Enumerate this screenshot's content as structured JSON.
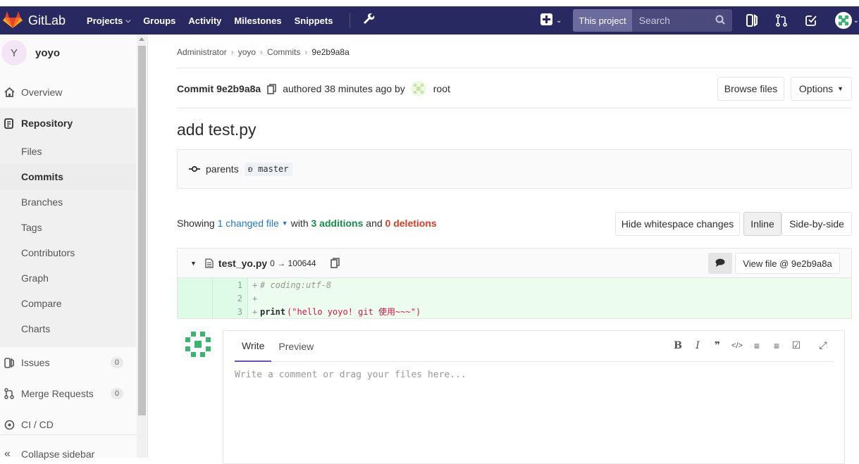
{
  "topbar": {
    "brand": "GitLab",
    "nav": [
      "Projects",
      "Groups",
      "Activity",
      "Milestones",
      "Snippets"
    ],
    "search_scope": "This project",
    "search_placeholder": "Search"
  },
  "sidebar": {
    "project_initial": "Y",
    "project_name": "yoyo",
    "overview": "Overview",
    "repository": "Repository",
    "repo_items": [
      "Files",
      "Commits",
      "Branches",
      "Tags",
      "Contributors",
      "Graph",
      "Compare",
      "Charts"
    ],
    "issues": "Issues",
    "issues_count": "0",
    "merge_requests": "Merge Requests",
    "mr_count": "0",
    "ci_cd": "CI / CD",
    "collapse": "Collapse sidebar"
  },
  "breadcrumb": [
    "Administrator",
    "yoyo",
    "Commits",
    "9e2b9a8a"
  ],
  "commit": {
    "label": "Commit",
    "sha": "9e2b9a8a",
    "authored": "authored 38 minutes ago by",
    "author": "root",
    "browse_files": "Browse files",
    "options": "Options",
    "title": "add test.py",
    "parents_label": "parents",
    "parent_ref": "master"
  },
  "stats": {
    "showing": "Showing",
    "changed": "1 changed file",
    "with": "with",
    "additions": "3 additions",
    "and": "and",
    "deletions": "0 deletions",
    "hide_ws": "Hide whitespace changes",
    "inline": "Inline",
    "side_by_side": "Side-by-side"
  },
  "diff": {
    "filename": "test_yo.py",
    "mode": "0 → 100644",
    "view_file": "View file @ 9e2b9a8a",
    "lines": [
      {
        "num": "1",
        "prefix": "+",
        "code": "# coding:utf-8"
      },
      {
        "num": "2",
        "prefix": "+",
        "code": ""
      },
      {
        "num": "3",
        "prefix": "+",
        "code_kw": "print",
        "code_str": "(\"hello yoyo! git 使用~~~\")"
      }
    ]
  },
  "note": {
    "write": "Write",
    "preview": "Preview",
    "placeholder": "Write a comment or drag your files here..."
  },
  "colors": {
    "topbar": "#292961",
    "accent": "#1f78d1",
    "additions": "#168f48",
    "deletions": "#db3b21"
  }
}
